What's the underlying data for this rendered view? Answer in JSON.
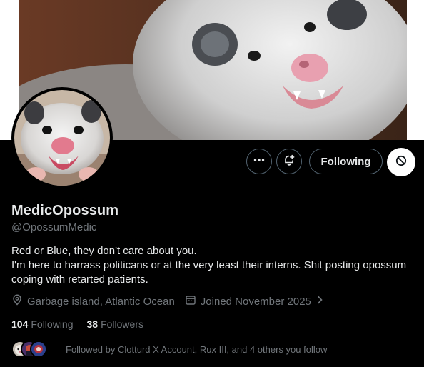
{
  "profile": {
    "display_name": "MedicOpossum",
    "handle": "@OpossumMedic",
    "bio_line1": "Red or Blue, they don't care about you.",
    "bio_line2": "I'm here to harrass politicans or at the very least their interns. Shit posting opossum coping with retarted patients.",
    "location": "Garbage island, Atlantic Ocean",
    "joined": "Joined November 2025"
  },
  "actions": {
    "following_label": "Following",
    "more_icon": "more-icon",
    "notify_icon": "bell-plus-icon",
    "block_icon": "block-icon"
  },
  "counts": {
    "following_num": "104",
    "following_label": "Following",
    "followers_num": "38",
    "followers_label": "Followers"
  },
  "followed_by": {
    "text": "Followed by Clotturd X Account, Rux III, and 4 others you follow"
  },
  "colors": {
    "background": "#000000",
    "primary_text": "#e7e9ea",
    "secondary_text": "#71767b",
    "border": "#536471"
  }
}
